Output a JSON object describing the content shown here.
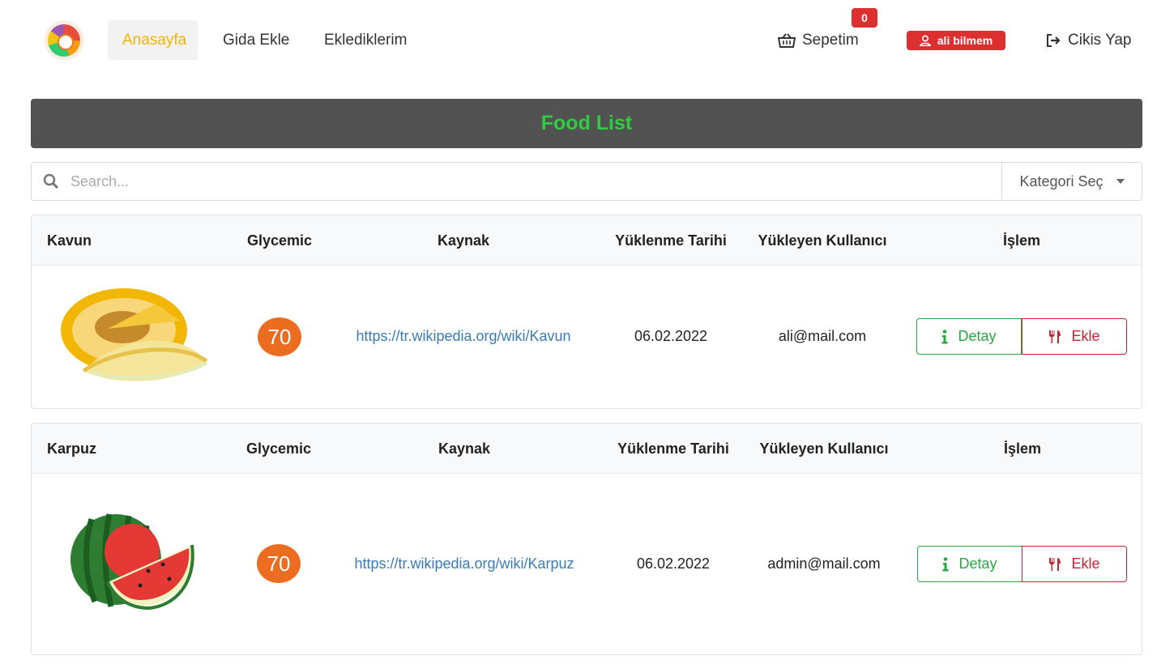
{
  "nav": {
    "home": "Anasayfa",
    "add_food": "Gida Ekle",
    "my_items": "Eklediklerim",
    "cart": "Sepetim",
    "cart_count": "0",
    "user": "ali bilmem",
    "logout": "Cikis Yap"
  },
  "page": {
    "title": "Food List"
  },
  "search": {
    "placeholder": "Search...",
    "category": "Kategori Seç"
  },
  "columns": {
    "glycemic": "Glycemic",
    "source": "Kaynak",
    "date": "Yüklenme Tarihi",
    "user": "Yükleyen Kullanıcı",
    "action": "İşlem"
  },
  "buttons": {
    "detail": "Detay",
    "add": "Ekle"
  },
  "foods": [
    {
      "name": "Kavun",
      "glycemic": "70",
      "source": "https://tr.wikipedia.org/wiki/Kavun",
      "date": "06.02.2022",
      "user": "ali@mail.com"
    },
    {
      "name": "Karpuz",
      "glycemic": "70",
      "source": "https://tr.wikipedia.org/wiki/Karpuz",
      "date": "06.02.2022",
      "user": "admin@mail.com"
    }
  ],
  "colors": {
    "accent": "#f5b400",
    "danger": "#dc2f2f",
    "success": "#28a745",
    "title": "#2ecc40",
    "glycemic": "#ec6d1f"
  }
}
